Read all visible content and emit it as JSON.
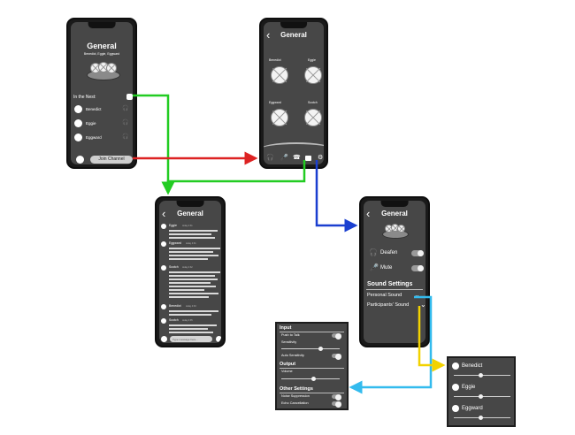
{
  "phone1": {
    "title": "General",
    "subtitle": "Benedict, Eggie, Eggward",
    "nest_label": "In the Nest:",
    "members": [
      "Benedict",
      "Eggie",
      "Eggward"
    ],
    "join_label": "Join Channel"
  },
  "phone2": {
    "title": "General",
    "eggs": [
      "Benedict",
      "Eggie",
      "Eggward",
      "Scotch"
    ]
  },
  "phone3": {
    "title": "General",
    "messages": [
      {
        "name": "Eggie",
        "time": "today 4:31"
      },
      {
        "name": "Eggward",
        "time": "today 4:31"
      },
      {
        "name": "Scotch",
        "time": "today 4:32"
      },
      {
        "name": "Benedict",
        "time": "today 4:33"
      },
      {
        "name": "Scotch",
        "time": "today 4:35"
      }
    ],
    "input_placeholder": "Type message here..."
  },
  "phone4": {
    "title": "General",
    "deafen": "Deafen",
    "mute": "Mute",
    "sound_settings": "Sound Settings",
    "personal_sound": "Personal Sound",
    "participants_sound": "Participants' Sound"
  },
  "personal_panel": {
    "input_heading": "Input",
    "push_to_talk": "Push to Talk",
    "sensitivity": "Sensitivity",
    "auto_sensitivity": "Auto Sensitivity",
    "output_heading": "Output",
    "volume": "Volume",
    "other_heading": "Other Settings",
    "noise_suppression": "Noise Suppression",
    "echo_cancellation": "Echo Cancellation"
  },
  "participants_panel": {
    "members": [
      "Benedict",
      "Eggie",
      "Eggward"
    ]
  },
  "colors": {
    "green": "#22cc22",
    "red": "#dd2222",
    "blue": "#1a3fd0",
    "cyan": "#33bbee",
    "yellow": "#f2d200"
  }
}
